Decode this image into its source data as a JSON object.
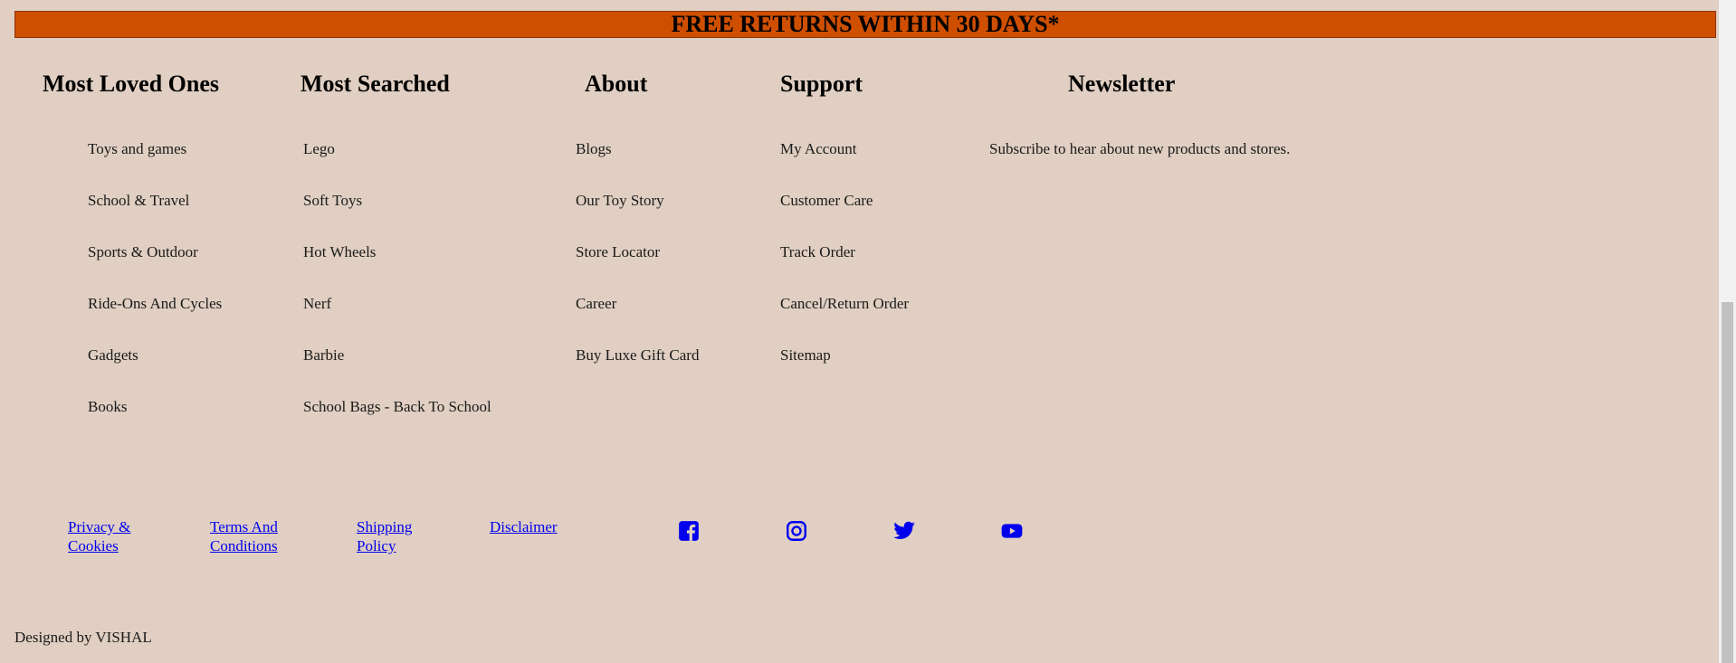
{
  "banner": {
    "text": "FREE RETURNS WITHIN 30 DAYS*"
  },
  "columns": {
    "most_loved": {
      "heading": "Most Loved Ones",
      "items": [
        "Toys and games",
        "School & Travel",
        "Sports & Outdoor",
        "Ride-Ons And Cycles",
        "Gadgets",
        "Books"
      ]
    },
    "most_searched": {
      "heading": "Most Searched",
      "items": [
        "Lego",
        "Soft Toys",
        "Hot Wheels",
        "Nerf",
        "Barbie",
        "School Bags - Back To School"
      ]
    },
    "about": {
      "heading": "About",
      "items": [
        "Blogs",
        "Our Toy Story",
        "Store Locator",
        "Career",
        "Buy Luxe Gift Card"
      ]
    },
    "support": {
      "heading": "Support",
      "items": [
        "My Account",
        "Customer Care",
        "Track Order",
        "Cancel/Return Order",
        "Sitemap"
      ]
    },
    "newsletter": {
      "heading": "Newsletter",
      "text": "Subscribe to hear about new products and stores."
    }
  },
  "legal_links": [
    {
      "line1": "Privacy &",
      "line2": "Cookies"
    },
    {
      "line1": "Terms And",
      "line2": "Conditions"
    },
    {
      "line1": "Shipping",
      "line2": "Policy"
    },
    {
      "line1": "Disclaimer",
      "line2": ""
    }
  ],
  "social": {
    "icons": [
      "facebook-icon",
      "instagram-icon",
      "twitter-icon",
      "youtube-icon"
    ],
    "color": "#0000ee"
  },
  "credit": {
    "text": "Designed by VISHAL"
  },
  "colors": {
    "background": "#e0cfc2",
    "banner": "#cf4f00",
    "link": "#0000ee"
  }
}
